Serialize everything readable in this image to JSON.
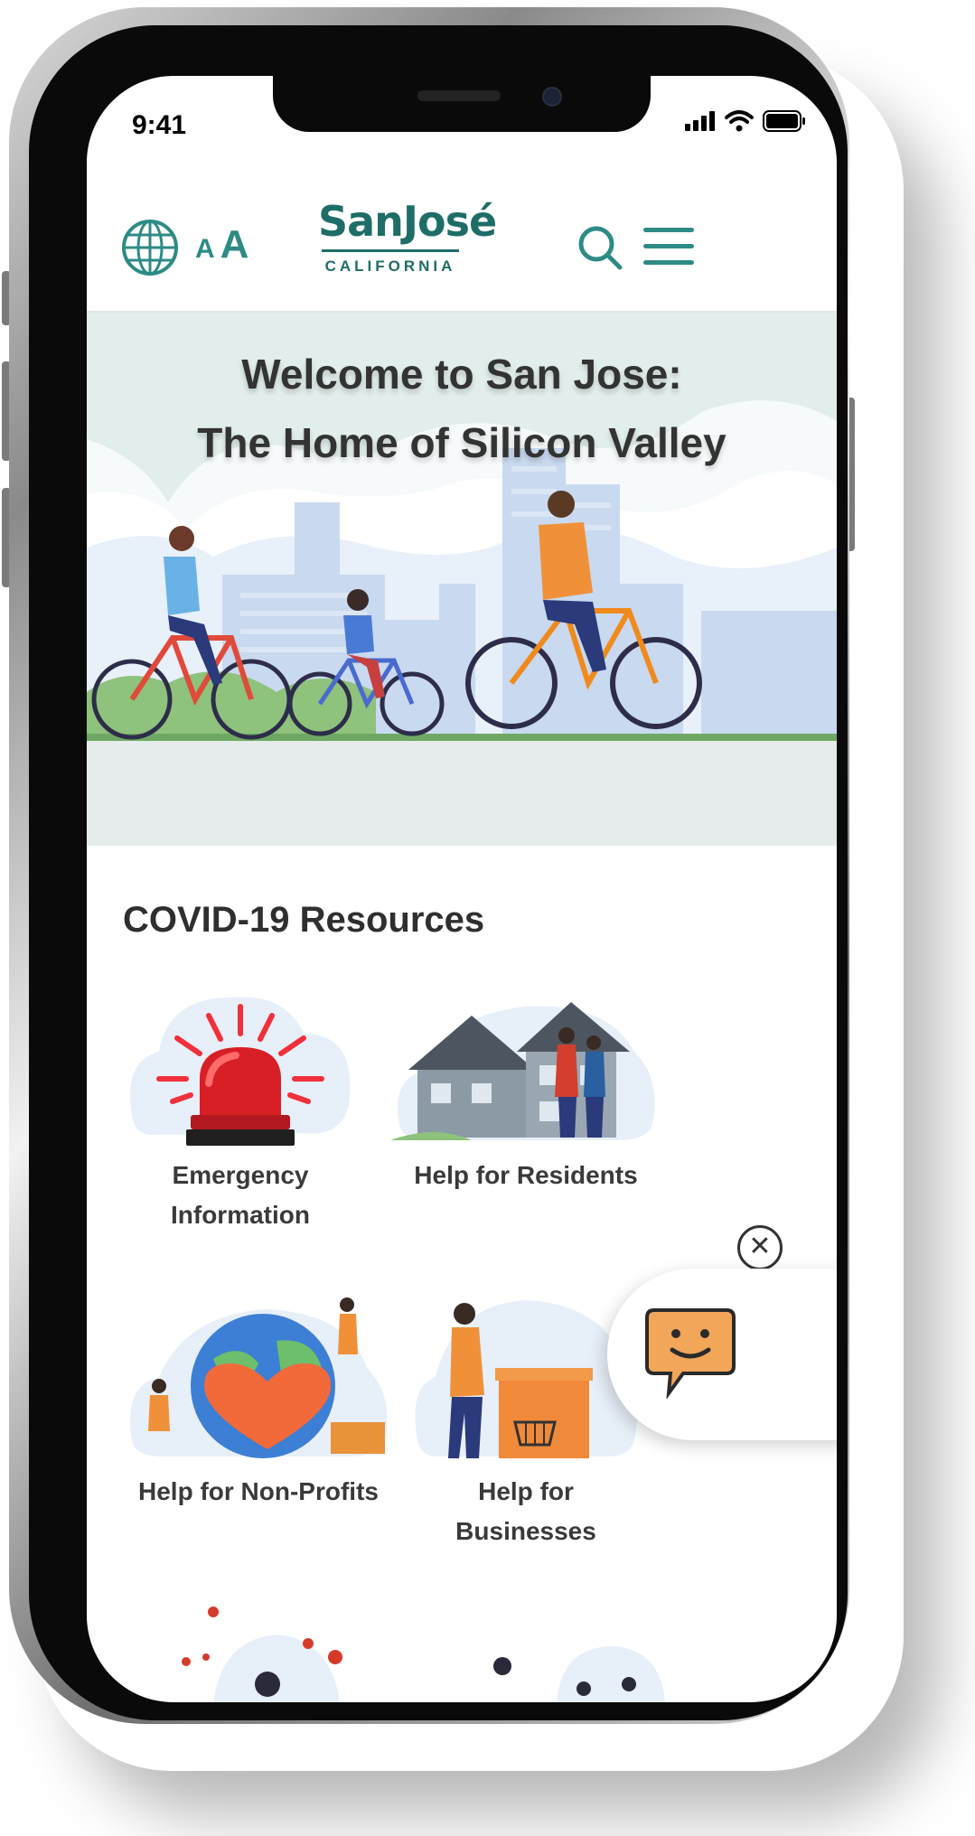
{
  "status_bar": {
    "time": "9:41",
    "icons": [
      "signal-icon",
      "wifi-icon",
      "battery-icon"
    ]
  },
  "header": {
    "language_icon": "globe-icon",
    "text_size_small": "A",
    "text_size_large": "A",
    "logo_title": "SanJosé",
    "logo_subtitle": "CALIFORNIA",
    "search_icon": "search-icon",
    "menu_icon": "hamburger-menu-icon",
    "accent_color": "#2e8b85"
  },
  "hero": {
    "title_line1": "Welcome to San Jose:",
    "title_line2": "The Home of Silicon Valley"
  },
  "covid": {
    "title": "COVID-19 Resources",
    "cards": [
      {
        "line1": "Emergency",
        "line2": "Information",
        "icon": "emergency-siren-icon"
      },
      {
        "line1": "Help for Residents",
        "line2": "",
        "icon": "residents-house-icon"
      },
      {
        "line1": "Help for Non-Profits",
        "line2": "",
        "icon": "nonprofits-globe-heart-icon"
      },
      {
        "line1": "Help for",
        "line2": "Businesses",
        "icon": "business-shop-icon"
      }
    ]
  },
  "chat_widget": {
    "close_symbol": "✕",
    "icon": "smiley-chat-icon"
  }
}
